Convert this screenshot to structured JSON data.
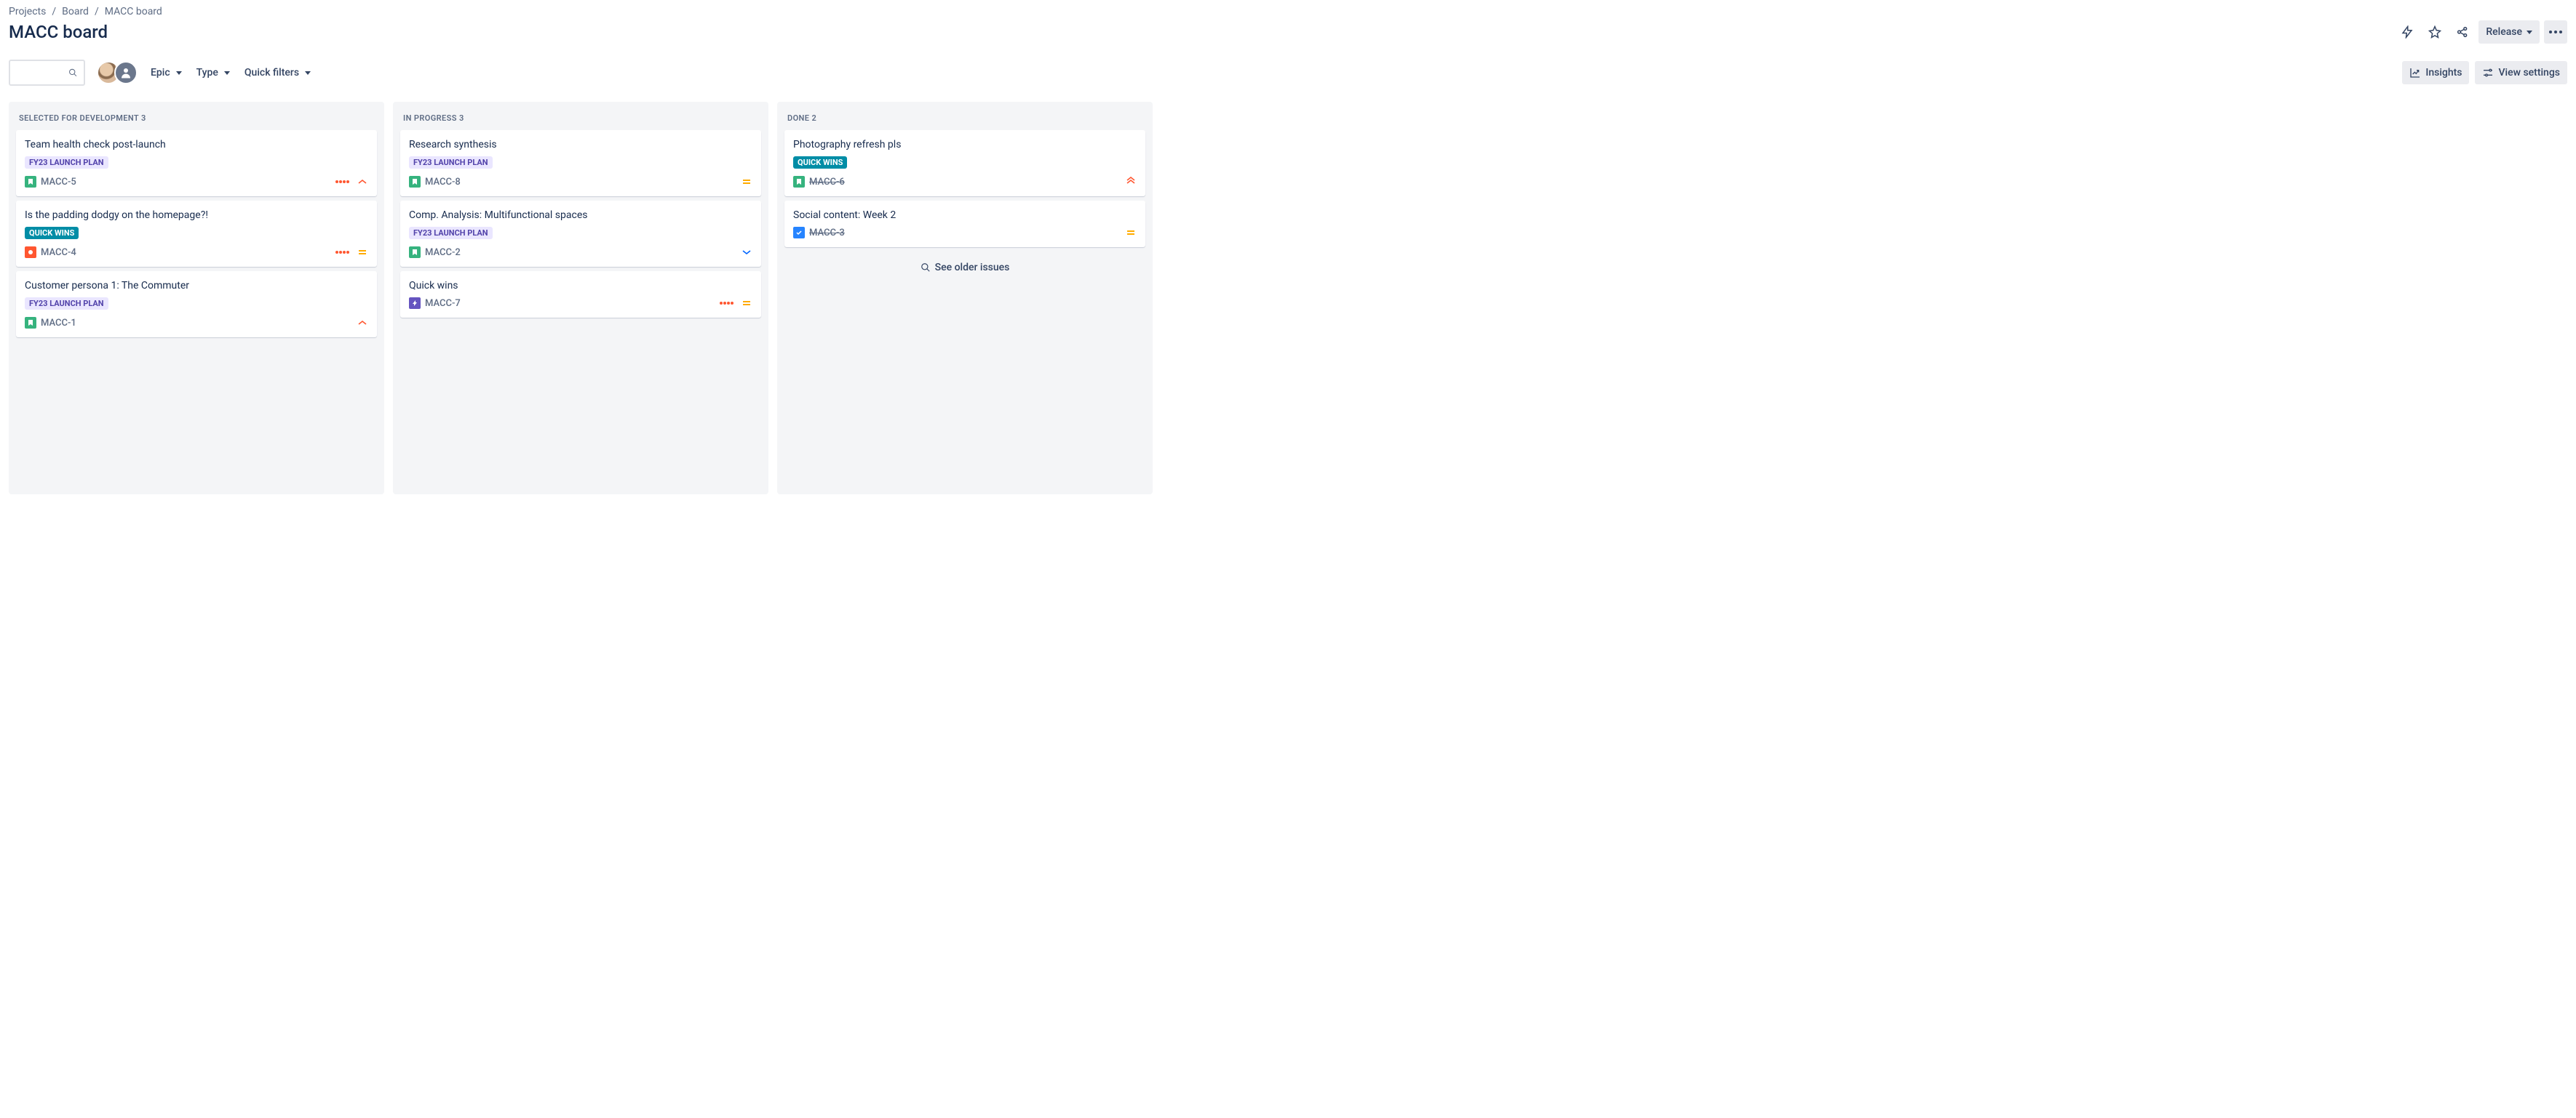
{
  "breadcrumbs": [
    "Projects",
    "Board",
    "MACC board"
  ],
  "page_title": "MACC board",
  "header_actions": {
    "release": "Release",
    "insights": "Insights",
    "view_settings": "View settings"
  },
  "filters": {
    "epic": "Epic",
    "type": "Type",
    "quick": "Quick filters"
  },
  "columns": [
    {
      "title": "Selected for Development",
      "count": 3,
      "see_older": false,
      "cards": [
        {
          "title": "Team health check post-launch",
          "label_text": "FY23 LAUNCH PLAN",
          "label_style": "purple",
          "type": "story",
          "key": "MACC-5",
          "done": false,
          "show_dots": true,
          "priority": "high"
        },
        {
          "title": "Is the padding dodgy on the homepage?!",
          "label_text": "QUICK WINS",
          "label_style": "teal",
          "type": "bug",
          "key": "MACC-4",
          "done": false,
          "show_dots": true,
          "priority": "medium"
        },
        {
          "title": "Customer persona 1: The Commuter",
          "label_text": "FY23 LAUNCH PLAN",
          "label_style": "purple",
          "type": "story",
          "key": "MACC-1",
          "done": false,
          "show_dots": false,
          "priority": "high"
        }
      ]
    },
    {
      "title": "In Progress",
      "count": 3,
      "see_older": false,
      "cards": [
        {
          "title": "Research synthesis",
          "label_text": "FY23 LAUNCH PLAN",
          "label_style": "purple",
          "type": "story",
          "key": "MACC-8",
          "done": false,
          "show_dots": false,
          "priority": "medium"
        },
        {
          "title": "Comp. Analysis: Multifunctional spaces",
          "label_text": "FY23 LAUNCH PLAN",
          "label_style": "purple",
          "type": "story",
          "key": "MACC-2",
          "done": false,
          "show_dots": false,
          "priority": "low"
        },
        {
          "title": "Quick wins",
          "label_text": "",
          "label_style": "",
          "type": "epic",
          "key": "MACC-7",
          "done": false,
          "show_dots": true,
          "priority": "medium"
        }
      ]
    },
    {
      "title": "Done",
      "count": 2,
      "see_older": true,
      "see_older_label": "See older issues",
      "cards": [
        {
          "title": "Photography refresh pls",
          "label_text": "QUICK WINS",
          "label_style": "teal",
          "type": "story",
          "key": "MACC-6",
          "done": true,
          "show_dots": false,
          "priority": "highest"
        },
        {
          "title": "Social content: Week 2",
          "label_text": "",
          "label_style": "",
          "type": "task",
          "key": "MACC-3",
          "done": true,
          "show_dots": false,
          "priority": "medium"
        }
      ]
    }
  ]
}
